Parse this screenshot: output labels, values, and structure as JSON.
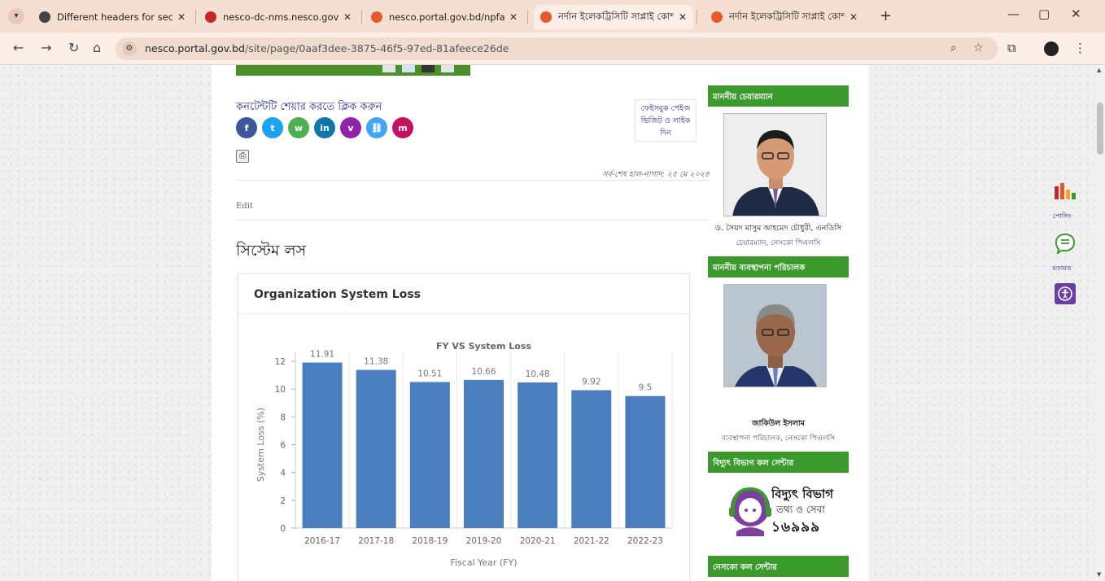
{
  "browser": {
    "tabs": [
      {
        "title": "Different headers for sections",
        "favicon_color": "#444444",
        "active": false
      },
      {
        "title": "nesco-dc-nms.nesco.gov.bd: H",
        "favicon_color": "#c62828",
        "active": false
      },
      {
        "title": "nesco.portal.gov.bd/npfadmin/",
        "favicon_color": "#e8582b",
        "active": false
      },
      {
        "title": "নর্দান ইলেকট্রিসিটি সাপ্লাই কোম্প",
        "favicon_color": "#e8582b",
        "active": true
      },
      {
        "title": "নর্দান ইলেকট্রিসিটি সাপ্লাই কোম্প",
        "favicon_color": "#e8582b",
        "active": false
      }
    ],
    "url_host": "nesco.portal.gov.bd",
    "url_path": "/site/page/0aaf3dee-3875-46f5-97ed-81afeece26de"
  },
  "page": {
    "share_title": "কনটেন্টটি শেয়ার করতে ক্লিক করুন",
    "share_buttons": [
      {
        "icon": "facebook-icon",
        "glyph": "f",
        "color": "#3b5998"
      },
      {
        "icon": "twitter-icon",
        "glyph": "t",
        "color": "#1da1f2"
      },
      {
        "icon": "whatsapp-icon",
        "glyph": "w",
        "color": "#4caf50"
      },
      {
        "icon": "linkedin-icon",
        "glyph": "in",
        "color": "#0e76a8"
      },
      {
        "icon": "viber-icon",
        "glyph": "v",
        "color": "#8e24aa"
      },
      {
        "icon": "link-icon",
        "glyph": "⛓",
        "color": "#42a5f5"
      },
      {
        "icon": "messenger-icon",
        "glyph": "m",
        "color": "#c51162"
      }
    ],
    "fb_box": [
      "ফেইসবুক পেইজ",
      "ভিজিট ও লাইক",
      "দিন"
    ],
    "last_updated": "সর্ব-শেষ হাল-নাগাদ: ২৫ মে ২০২৪",
    "edit_label": "Edit",
    "page_title": "সিস্টেম লস",
    "card_title": "Organization System Loss"
  },
  "chart_data": {
    "type": "bar",
    "title": "FY VS System Loss",
    "xlabel": "Fiscal Year (FY)",
    "ylabel": "System Loss (%)",
    "categories": [
      "2016-17",
      "2017-18",
      "2018-19",
      "2019-20",
      "2020-21",
      "2021-22",
      "2022-23"
    ],
    "values": [
      11.91,
      11.38,
      10.51,
      10.66,
      10.48,
      9.92,
      9.5
    ],
    "ylim": [
      0,
      12
    ],
    "yticks": [
      0,
      2,
      4,
      6,
      8,
      10,
      12
    ],
    "bar_color": "#4a7ebf",
    "grid": "vertical-light"
  },
  "sidebar": {
    "chairman_head": "মাননীয় চেয়ারম্যান",
    "chairman_name": "ড. সৈয়দ মাসুম আহমেদ চৌধুরী, এনডিসি",
    "chairman_role": "চেয়ারম্যান, নেসকো পিএলসি",
    "md_head": "মাননীয় ব্যবস্থাপনা পরিচালক",
    "md_name": "জাকিউল ইসলাম",
    "md_role": "ব্যবস্থাপনা পরিচালক, নেসকো পিএলসি",
    "call_head": "বিদ্যুৎ বিভাগ কল সেন্টার",
    "help_line1": "বিদ্যুৎ বিভাগ",
    "help_line2": "তথ্য ও সেবা",
    "help_number": "১৬৯৯৯",
    "nesco_head": "নেসকো কল সেন্টার",
    "accent": "#3a9a2c"
  },
  "float": {
    "poll_label": "পোলিং",
    "feedback_label": "মতামত"
  }
}
